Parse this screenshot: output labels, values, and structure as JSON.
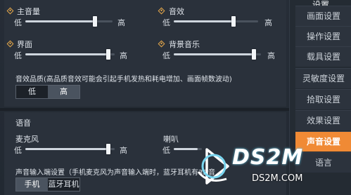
{
  "sidebar": {
    "title": "设置",
    "items": [
      {
        "label": "画面设置"
      },
      {
        "label": "操作设置"
      },
      {
        "label": "载具设置"
      },
      {
        "label": "灵敏度设置"
      },
      {
        "label": "拾取设置"
      },
      {
        "label": "效果设置"
      },
      {
        "label": "声音设置",
        "active": true
      },
      {
        "label": "语言"
      }
    ]
  },
  "volume": {
    "low_label": "低",
    "high_label": "高",
    "sliders": [
      {
        "label": "主音量",
        "value": 0.8
      },
      {
        "label": "音效",
        "value": 0.71
      },
      {
        "label": "界面",
        "value": 0.93
      },
      {
        "label": "背景音乐",
        "value": 0.92
      }
    ]
  },
  "quality": {
    "label": "音效品质(高品质音效可能会引起手机发热和耗电增加、画面帧数波动)",
    "options": [
      "低",
      "高"
    ],
    "selected": "高"
  },
  "voice": {
    "section_label": "语音",
    "sliders": [
      {
        "label": "麦克风",
        "value": 0.93
      },
      {
        "label": "喇叭",
        "value": 0.85
      }
    ]
  },
  "input": {
    "label": "声音输入端设置（手机麦克风为声音输入端时，蓝牙耳机有3D音",
    "options": [
      "手机",
      "蓝牙耳机"
    ],
    "selected": "手机"
  },
  "watermark": {
    "brand": "DS2M",
    "domain": "DS2M.COM"
  },
  "colors": {
    "accent": "#f08a35",
    "diamond": "#e7a94a"
  }
}
